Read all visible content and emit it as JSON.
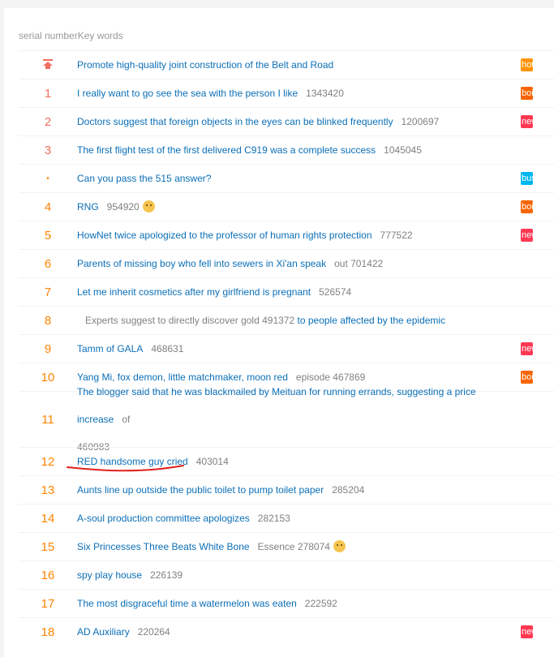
{
  "header": {
    "serial_label": "serial number",
    "keywords_label": "Key words"
  },
  "badge_colors": {
    "hot": "#ff9406",
    "boil": "#f86400",
    "new": "#ff3852",
    "business": "#00b7ee"
  },
  "pinned": {
    "icon": "pin-top-icon",
    "title": "Promote high-quality joint construction of the Belt and Road",
    "badge": {
      "type": "hot",
      "label": "hot"
    }
  },
  "rows": [
    {
      "rank": "1",
      "title": "I really want to go see the sea with the person I like",
      "count": "1343420",
      "badge": {
        "type": "boil",
        "label": "boil"
      }
    },
    {
      "rank": "2",
      "title": "Doctors suggest that foreign objects in the eyes can be blinked frequently",
      "count": "1200697",
      "badge": {
        "type": "new",
        "label": "new"
      }
    },
    {
      "rank": "3",
      "title": "The first flight test of the first delivered C919 was a complete success",
      "count": "1045045"
    },
    {
      "rank": "•",
      "title": "Can you pass the 515 answer?",
      "badge": {
        "type": "business",
        "label": "business"
      }
    },
    {
      "rank": "4",
      "title": "RNG",
      "count": "954920",
      "emoji": "doge-emoji-icon",
      "badge": {
        "type": "boil",
        "label": "boil"
      }
    },
    {
      "rank": "5",
      "title": "HowNet twice apologized to the professor of human rights protection",
      "count": "777522",
      "badge": {
        "type": "new",
        "label": "new"
      }
    },
    {
      "rank": "6",
      "title": "Parents of missing boy who fell into sewers in Xi'an speak",
      "count": "out 701422"
    },
    {
      "rank": "7",
      "title": "Let me inherit cosmetics after my girlfriend is pregnant",
      "count": "526574"
    },
    {
      "rank": "8",
      "pre": "Experts suggest to directly discover gold 491372",
      "title": "to people affected by the epidemic"
    },
    {
      "rank": "9",
      "title": "Tamm of GALA",
      "count": "468631",
      "badge": {
        "type": "new",
        "label": "new"
      }
    },
    {
      "rank": "10",
      "title": "Yang Mi, fox demon, little matchmaker, moon red",
      "count": "episode 467869",
      "badge": {
        "type": "boil",
        "label": "boil"
      }
    },
    {
      "rank": "11",
      "title": "The blogger said that he was blackmailed by Meituan for running errands, suggesting a price increase",
      "count": "of",
      "count2": "460983",
      "tall": true
    },
    {
      "rank": "12",
      "title": "RED handsome guy cried",
      "count": "403014",
      "annotated": true
    },
    {
      "rank": "13",
      "title": "Aunts line up outside the public toilet to pump toilet paper",
      "count": "285204"
    },
    {
      "rank": "14",
      "title": "A-soul production committee apologizes",
      "count": "282153"
    },
    {
      "rank": "15",
      "title": "Six Princesses Three Beats White Bone",
      "count": "Essence 278074",
      "emoji": "doge-emoji-icon"
    },
    {
      "rank": "16",
      "title": "spy play house",
      "count": "226139"
    },
    {
      "rank": "17",
      "title": "The most disgraceful time a watermelon was eaten",
      "count": "222592"
    },
    {
      "rank": "18",
      "title": "AD Auxiliary",
      "count": "220264",
      "badge": {
        "type": "new",
        "label": "new"
      }
    }
  ]
}
